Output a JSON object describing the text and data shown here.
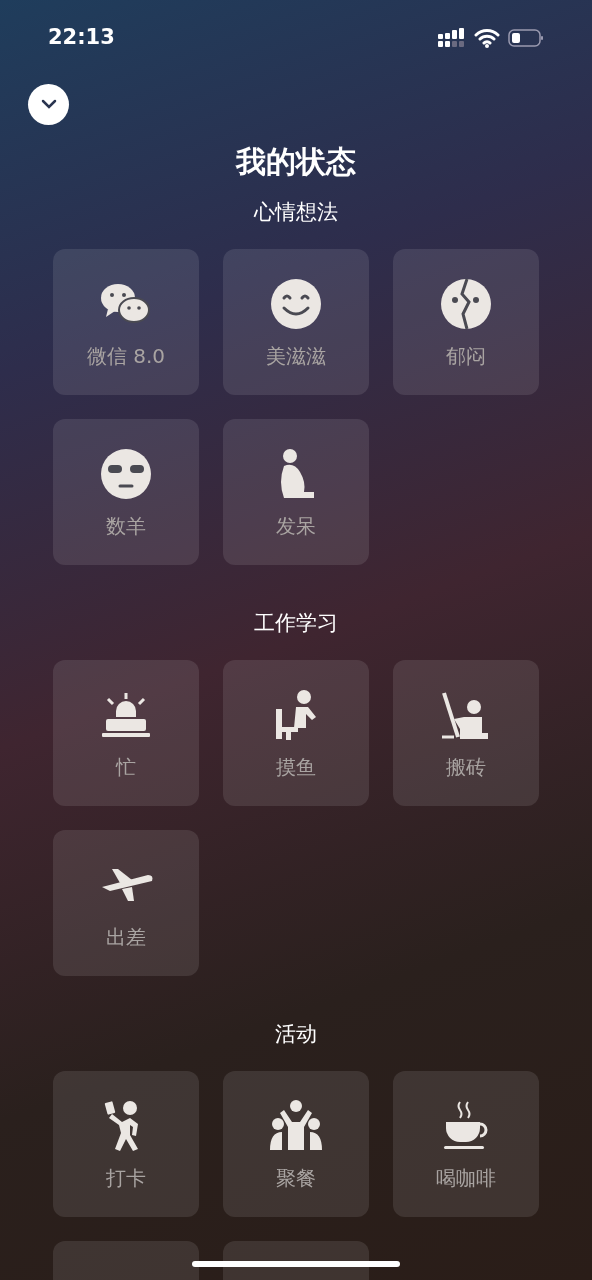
{
  "status_bar": {
    "time": "22:13"
  },
  "title": "我的状态",
  "sections": [
    {
      "heading": "心情想法",
      "items": [
        {
          "label": "微信 8.0"
        },
        {
          "label": "美滋滋"
        },
        {
          "label": "郁闷"
        },
        {
          "label": "数羊"
        },
        {
          "label": "发呆"
        }
      ]
    },
    {
      "heading": "工作学习",
      "items": [
        {
          "label": "忙"
        },
        {
          "label": "摸鱼"
        },
        {
          "label": "搬砖"
        },
        {
          "label": "出差"
        }
      ]
    },
    {
      "heading": "活动",
      "items": [
        {
          "label": "打卡"
        },
        {
          "label": "聚餐"
        },
        {
          "label": "喝咖啡"
        }
      ]
    }
  ]
}
